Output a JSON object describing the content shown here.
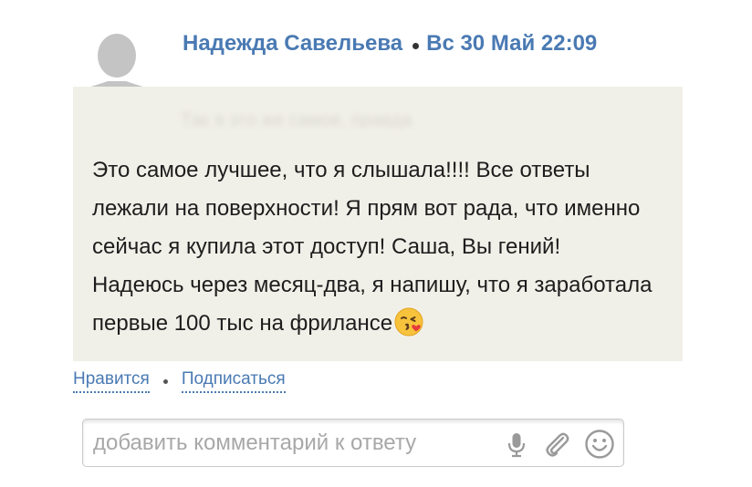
{
  "post": {
    "author": "Надежда Савельева",
    "date": "Вс 30 Май 22:09",
    "title_blurred": "Так я это же самое, правда",
    "text": "Это самое лучшее, что я слышала!!!! Все ответы лежали на поверхности! Я прям вот рада, что именно сейчас я купила этот доступ! Саша, Вы гений! Надеюсь через месяц-два, я напишу, что я заработала первые 100 тыс на фрилансе",
    "emoji": "kissing-face-with-heart-emoji"
  },
  "actions": {
    "like_label": "Нравится",
    "subscribe_label": "Подписаться"
  },
  "comment": {
    "placeholder": "добавить комментарий к ответу",
    "value": "",
    "icons": [
      "microphone-icon",
      "paperclip-icon",
      "smiley-icon"
    ]
  },
  "colors": {
    "accent": "#4a7ab3",
    "card_bg": "#f1f0e8",
    "text": "#1d1d1d",
    "placeholder": "#a8a8a8"
  }
}
